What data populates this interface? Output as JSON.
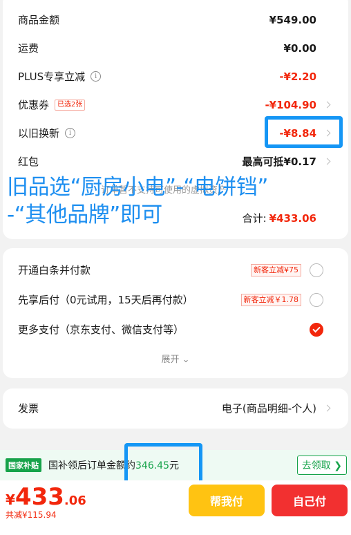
{
  "order_summary": {
    "goods_amount_label": "商品金额",
    "goods_amount_value": "¥549.00",
    "shipping_label": "运费",
    "shipping_value": "¥0.00",
    "plus_label": "PLUS专享立减",
    "plus_value": "-¥2.20",
    "coupon_label": "优惠券",
    "coupon_tag": "已选2张",
    "coupon_value": "-¥104.90",
    "tradein_label": "以旧换新",
    "tradein_value": "-¥8.84",
    "redpacket_label": "红包",
    "redpacket_value": "最高可抵¥0.17",
    "faded_hint": "订单暂不支持可使用的虚拟资产",
    "total_label": "合计:",
    "total_value": "¥433.06"
  },
  "annotation": {
    "line1": "旧品选“厨房小电”-“电饼铛”",
    "line2": "-“其他品牌”即可"
  },
  "payment": {
    "baitiao_label": "开通白条并付款",
    "baitiao_tag": "新客立减¥75",
    "later_label": "先享后付（0元试用，15天后再付款）",
    "later_tag": "新客立减￥1.78",
    "more_label": "更多支付（京东支付、微信支付等）",
    "expand_label": "展开 ⌄"
  },
  "invoice": {
    "label": "发票",
    "value": "电子(商品明细-个人)"
  },
  "subsidy": {
    "badge": "国家补贴",
    "text_prefix": "国补领后订单金额约",
    "amount": "346.45",
    "unit": "元",
    "claim": "去领取 ❯"
  },
  "bottom": {
    "price_currency": "¥",
    "price_int": "433",
    "price_dec": ".06",
    "saved": "共减¥115.94",
    "help_pay": "帮我付",
    "self_pay": "自己付"
  },
  "colors": {
    "accent_red": "#f2270c",
    "annotation_blue": "#1596f5",
    "subsidy_green": "#16a34a",
    "help_yellow": "#ffc312"
  }
}
